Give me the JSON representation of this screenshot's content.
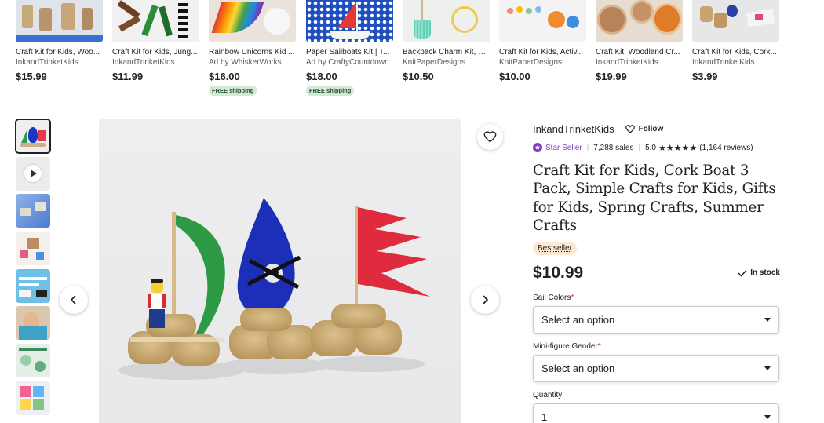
{
  "related": [
    {
      "title": "Craft Kit for Kids, Woo...",
      "shop": "InkandTrinketKids",
      "price": "$15.99",
      "shipping": "",
      "ad": false
    },
    {
      "title": "Craft Kit for Kids, Jung...",
      "shop": "InkandTrinketKids",
      "price": "$11.99",
      "shipping": "",
      "ad": false
    },
    {
      "title": "Rainbow Unicorns Kid ...",
      "shop": "Ad by WhiskerWorks",
      "price": "$16.00",
      "shipping": "FREE shipping",
      "ad": true
    },
    {
      "title": "Paper Sailboats Kit | T...",
      "shop": "Ad by CraftyCountdown",
      "price": "$18.00",
      "shipping": "FREE shipping",
      "ad": true
    },
    {
      "title": "Backpack Charm Kit, B...",
      "shop": "KnitPaperDesigns",
      "price": "$10.50",
      "shipping": "",
      "ad": false
    },
    {
      "title": "Craft Kit for Kids, Activ...",
      "shop": "KnitPaperDesigns",
      "price": "$10.00",
      "shipping": "",
      "ad": false
    },
    {
      "title": "Craft Kit, Woodland Cr...",
      "shop": "InkandTrinketKids",
      "price": "$19.99",
      "shipping": "",
      "ad": false
    },
    {
      "title": "Craft Kit for Kids, Cork...",
      "shop": "InkandTrinketKids",
      "price": "$3.99",
      "shipping": "",
      "ad": false
    }
  ],
  "shop": {
    "name": "InkandTrinketKids",
    "follow_label": "Follow",
    "star_seller": "Star Seller",
    "sales": "7,288 sales",
    "rating": "5.0",
    "stars": "★★★★★",
    "reviews": "(1,164 reviews)"
  },
  "product": {
    "title": "Craft Kit for Kids, Cork Boat 3 Pack, Simple Crafts for Kids, Gifts for Kids, Spring Crafts, Summer Crafts",
    "badge": "Bestseller",
    "price": "$10.99",
    "stock": "In stock"
  },
  "options": {
    "sail_label": "Sail Colors",
    "sail_value": "Select an option",
    "gender_label": "Mini-figure Gender",
    "gender_value": "Select an option",
    "qty_label": "Quantity",
    "qty_value": "1",
    "required_mark": "*"
  },
  "colors": {
    "star_seller": "#7f3fbf",
    "bestseller_bg": "#fde9d2",
    "free_shipping_bg": "#d4e9d7",
    "required": "#c92a2a"
  }
}
